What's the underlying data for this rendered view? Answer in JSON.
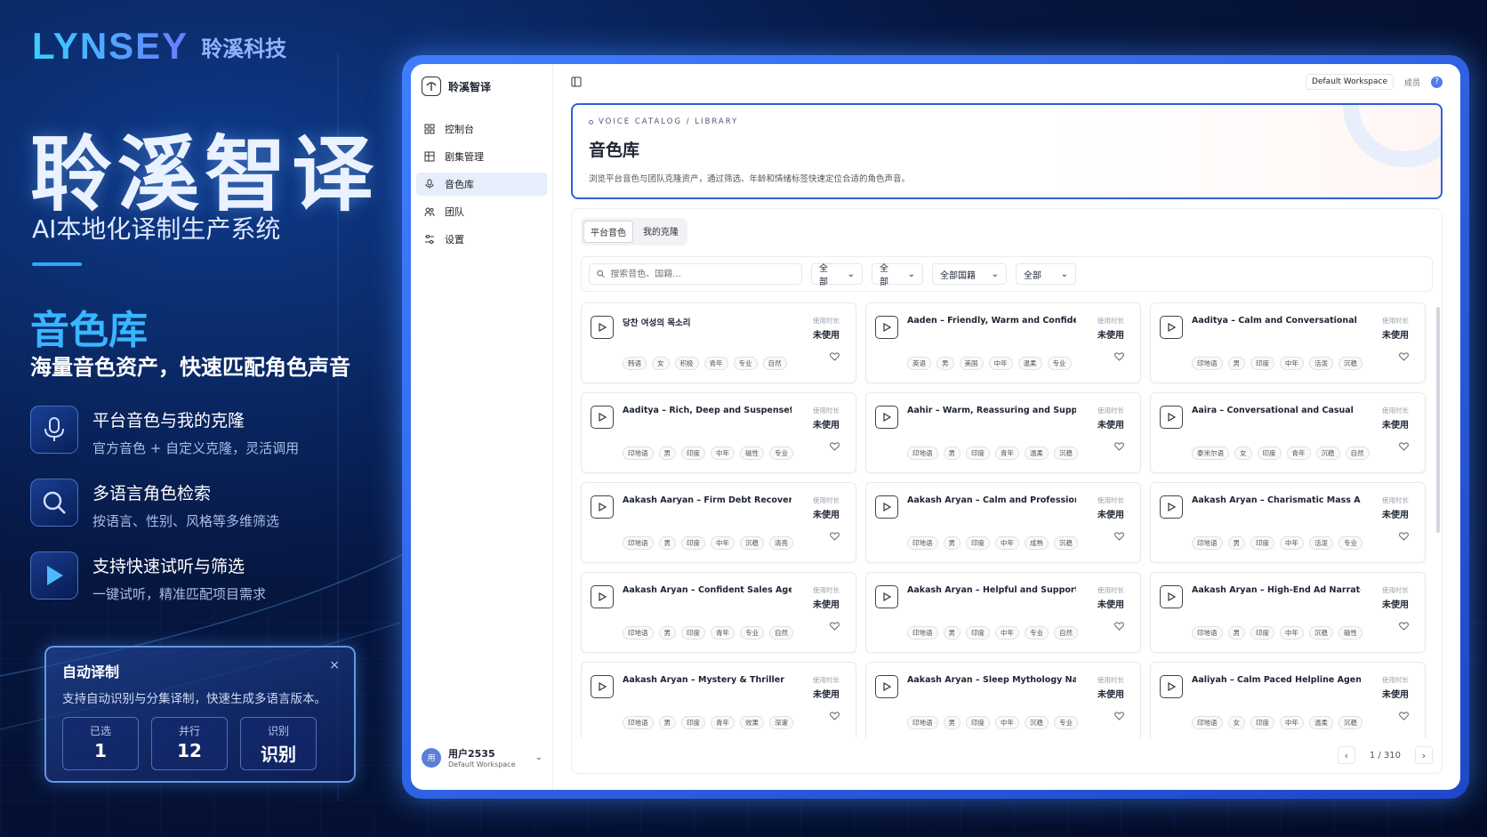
{
  "brand": {
    "logo": "LYNSEY",
    "cn": "聆溪科技"
  },
  "hero": {
    "title": "聆溪智译",
    "subtitle": "AI本地化译制生产系统"
  },
  "section": {
    "title": "音色库",
    "subtitle": "海量音色资产，快速匹配角色声音"
  },
  "features": [
    {
      "icon": "microphone-icon",
      "title": "平台音色与我的克隆",
      "desc": "官方音色 + 自定义克隆，灵活调用"
    },
    {
      "icon": "search-icon",
      "title": "多语言角色检索",
      "desc": "按语言、性别、风格等多维筛选"
    },
    {
      "icon": "play-icon",
      "title": "支持快速试听与筛选",
      "desc": "一键试听，精准匹配项目需求"
    }
  ],
  "auto_card": {
    "title": "自动译制",
    "close": "×",
    "desc": "支持自动识别与分集译制，快速生成多语言版本。",
    "stats": [
      {
        "label": "已选",
        "value": "1"
      },
      {
        "label": "并行",
        "value": "12"
      },
      {
        "label": "识别",
        "value": "识别"
      }
    ]
  },
  "app": {
    "brand_name": "聆溪智译",
    "nav": [
      {
        "label": "控制台",
        "icon": "dashboard-icon",
        "active": false
      },
      {
        "label": "剧集管理",
        "icon": "grid-icon",
        "active": false
      },
      {
        "label": "音色库",
        "icon": "microphone-icon",
        "active": true
      },
      {
        "label": "团队",
        "icon": "team-icon",
        "active": false
      },
      {
        "label": "设置",
        "icon": "settings-icon",
        "active": false
      }
    ],
    "user": {
      "avatar": "用",
      "name": "用户2535",
      "workspace": "Default Workspace"
    },
    "topbar": {
      "workspace": "Default Workspace",
      "member": "成员",
      "help": "?"
    },
    "library": {
      "eyebrow": "VOICE CATALOG / LIBRARY",
      "title": "音色库",
      "desc": "浏览平台音色与团队克隆资产，通过筛选、年龄和情绪标签快速定位合适的角色声音。"
    },
    "tabs": [
      {
        "label": "平台音色",
        "active": true
      },
      {
        "label": "我的克隆",
        "active": false
      }
    ],
    "search_placeholder": "搜索音色、国籍...",
    "filters": [
      "全部",
      "全部",
      "全部国籍",
      "全部"
    ],
    "usage_label": "使用时长",
    "voices": [
      {
        "name": "당찬 여성의 목소리",
        "usage": "未使用",
        "tags": [
          "韩语",
          "女",
          "积极",
          "青年",
          "专业",
          "自然"
        ]
      },
      {
        "name": "Aaden – Friendly, Warm and Confident",
        "usage": "未使用",
        "tags": [
          "英语",
          "男",
          "美国",
          "中年",
          "温柔",
          "专业"
        ]
      },
      {
        "name": "Aaditya – Calm and Conversational",
        "usage": "未使用",
        "tags": [
          "印地语",
          "男",
          "印度",
          "中年",
          "活泼",
          "沉稳"
        ]
      },
      {
        "name": "Aaditya – Rich, Deep and Suspenseful",
        "usage": "未使用",
        "tags": [
          "印地语",
          "男",
          "印度",
          "中年",
          "磁性",
          "专业"
        ]
      },
      {
        "name": "Aahir – Warm, Reassuring and Supportive",
        "usage": "未使用",
        "tags": [
          "印地语",
          "男",
          "印度",
          "青年",
          "温柔",
          "沉稳"
        ]
      },
      {
        "name": "Aaira – Conversational and Casual",
        "usage": "未使用",
        "tags": [
          "泰米尔语",
          "女",
          "印度",
          "青年",
          "沉稳",
          "自然"
        ]
      },
      {
        "name": "Aakash Aaryan – Firm Debt Recovery",
        "usage": "未使用",
        "tags": [
          "印地语",
          "男",
          "印度",
          "中年",
          "沉稳",
          "清亮"
        ]
      },
      {
        "name": "Aakash Aryan – Calm and Professional",
        "usage": "未使用",
        "tags": [
          "印地语",
          "男",
          "印度",
          "中年",
          "成熟",
          "沉稳"
        ]
      },
      {
        "name": "Aakash Aryan – Charismatic Mass Ads",
        "usage": "未使用",
        "tags": [
          "印地语",
          "男",
          "印度",
          "中年",
          "活泼",
          "专业"
        ]
      },
      {
        "name": "Aakash Aryan – Confident Sales Agent",
        "usage": "未使用",
        "tags": [
          "印地语",
          "男",
          "印度",
          "青年",
          "专业",
          "自然"
        ]
      },
      {
        "name": "Aakash Aryan – Helpful and Supportive",
        "usage": "未使用",
        "tags": [
          "印地语",
          "男",
          "印度",
          "中年",
          "专业",
          "自然"
        ]
      },
      {
        "name": "Aakash Aryan – High-End Ad Narrator",
        "usage": "未使用",
        "tags": [
          "印地语",
          "男",
          "印度",
          "中年",
          "沉稳",
          "磁性"
        ]
      },
      {
        "name": "Aakash Aryan – Mystery & Thriller",
        "usage": "未使用",
        "tags": [
          "印地语",
          "男",
          "印度",
          "青年",
          "效果",
          "深邃"
        ]
      },
      {
        "name": "Aakash Aryan – Sleep Mythology Narrator",
        "usage": "未使用",
        "tags": [
          "印地语",
          "男",
          "印度",
          "中年",
          "沉稳",
          "专业"
        ]
      },
      {
        "name": "Aaliyah – Calm Paced Helpline Agent",
        "usage": "未使用",
        "tags": [
          "印地语",
          "女",
          "印度",
          "中年",
          "温柔",
          "沉稳"
        ]
      }
    ],
    "pagination": {
      "text": "1 / 310",
      "prev": "‹",
      "next": "›"
    }
  },
  "colors": {
    "accent": "#2f5fd8",
    "brand_blue": "#38b6ff",
    "bg_dark": "#06163f"
  }
}
